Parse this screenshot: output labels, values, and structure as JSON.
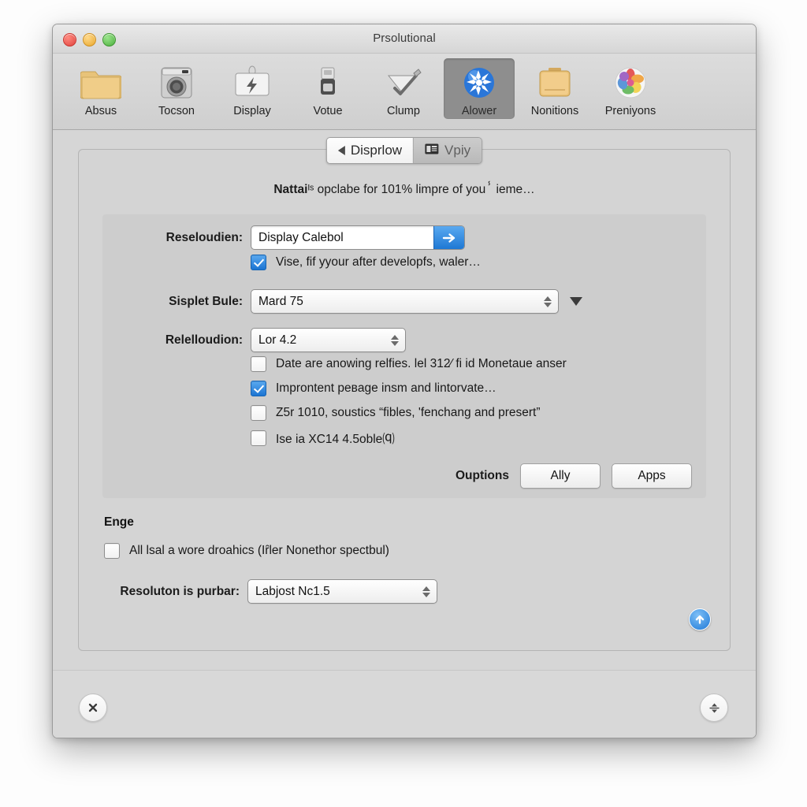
{
  "window": {
    "title": "Prsolutional",
    "controls": {
      "close": "close-button",
      "minimize": "minimize-button",
      "zoom": "zoom-button"
    }
  },
  "toolbar": {
    "items": [
      {
        "label": "Absus",
        "icon": "folder-icon"
      },
      {
        "label": "Tocson",
        "icon": "washer-icon"
      },
      {
        "label": "Display",
        "icon": "display-bolt-icon"
      },
      {
        "label": "Votue",
        "icon": "printer-icon"
      },
      {
        "label": "Clump",
        "icon": "check-pen-icon"
      },
      {
        "label": "Alower",
        "icon": "bluetooth-sparkle-icon",
        "selected": true
      },
      {
        "label": "Nonitions",
        "icon": "briefcase-icon"
      },
      {
        "label": "Preniyons",
        "icon": "photos-flower-icon"
      }
    ]
  },
  "tabs": [
    {
      "label": "Disprlow",
      "icon": "back-triangle-icon",
      "active": true
    },
    {
      "label": "Vpiy",
      "icon": "card-icon",
      "active": false
    }
  ],
  "main": {
    "headline_bold": "Nattai",
    "headline_rest": "ᴵˢ opclabe for 101% limpre of youⸯ ieme…",
    "fields": {
      "resolution": {
        "label": "Reseloudien:",
        "value": "Display Calebol",
        "go_icon": "arrow-right-icon"
      },
      "sisplet": {
        "label": "Sisplet Bule:",
        "value": "Mard 75"
      },
      "relelloudion": {
        "label": "Relelloudion:",
        "value": "Lor 4.2"
      },
      "purbar": {
        "label": "Resoluton is purbar:",
        "value": "Labjost Nc1.5"
      }
    },
    "checkboxes": {
      "under_resolution": {
        "label": "Vise, fif yyour after developfs, waler…",
        "checked": true
      },
      "list": [
        {
          "label": "Date are anowing relfies. lel 312⁄ fi id Monetaue anser",
          "checked": false
        },
        {
          "label": "Improntent peʙage insm and lintorvate…",
          "checked": true
        },
        {
          "label": "Z5r 1010, soustics “fibles, 'fenchang and presert”",
          "checked": false
        },
        {
          "label": "Ise ia XC14 4.5oble⒬",
          "checked": false
        }
      ],
      "engine": {
        "label": "All lsal a wore droahics (Iȓler Nonethor spectbul)",
        "checked": false
      }
    },
    "options_row": {
      "label": "Ouptions",
      "buttons": [
        "Ally",
        "Apps"
      ]
    },
    "section_engine": "Enge",
    "scroll_top_icon": "arrow-up-circle-icon"
  },
  "bottombar": {
    "left_icon": "close-x-icon",
    "right_icon": "sort-updown-icon"
  },
  "colors": {
    "accent_blue": "#1e78d4",
    "selected_toolbar": "#8e8e8e",
    "window_bg": "#d6d6d6",
    "groupbox_bg": "#cdcdcd"
  }
}
